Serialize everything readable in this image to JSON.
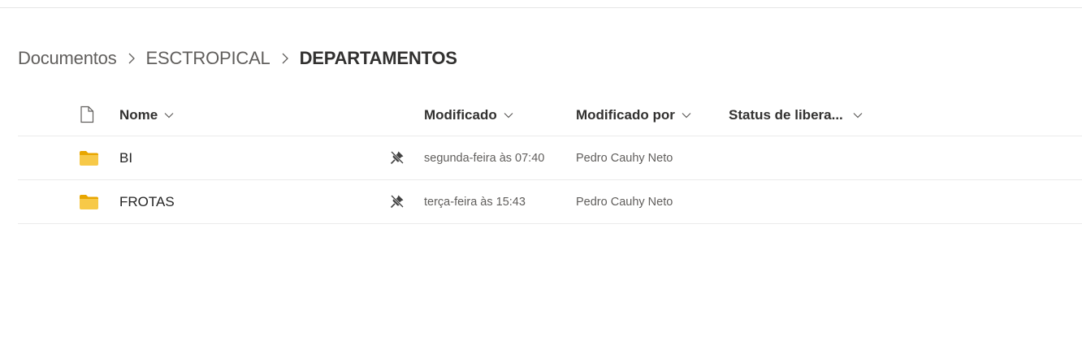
{
  "breadcrumb": {
    "items": [
      "Documentos",
      "ESCTROPICAL",
      "DEPARTAMENTOS"
    ]
  },
  "columns": {
    "name": "Nome",
    "modified": "Modificado",
    "modified_by": "Modificado por",
    "status": "Status de libera..."
  },
  "rows": [
    {
      "name": "BI",
      "modified": "segunda-feira às 07:40",
      "modified_by": "Pedro Cauhy Neto",
      "icon": "folder-icon"
    },
    {
      "name": "FROTAS",
      "modified": "terça-feira às 15:43",
      "modified_by": "Pedro Cauhy Neto",
      "icon": "folder-icon"
    }
  ],
  "colors": {
    "folder": "#f7c948",
    "folder_dark": "#e8a600",
    "text_primary": "#242424",
    "text_secondary": "#605e5c",
    "divider": "#ebebeb"
  }
}
